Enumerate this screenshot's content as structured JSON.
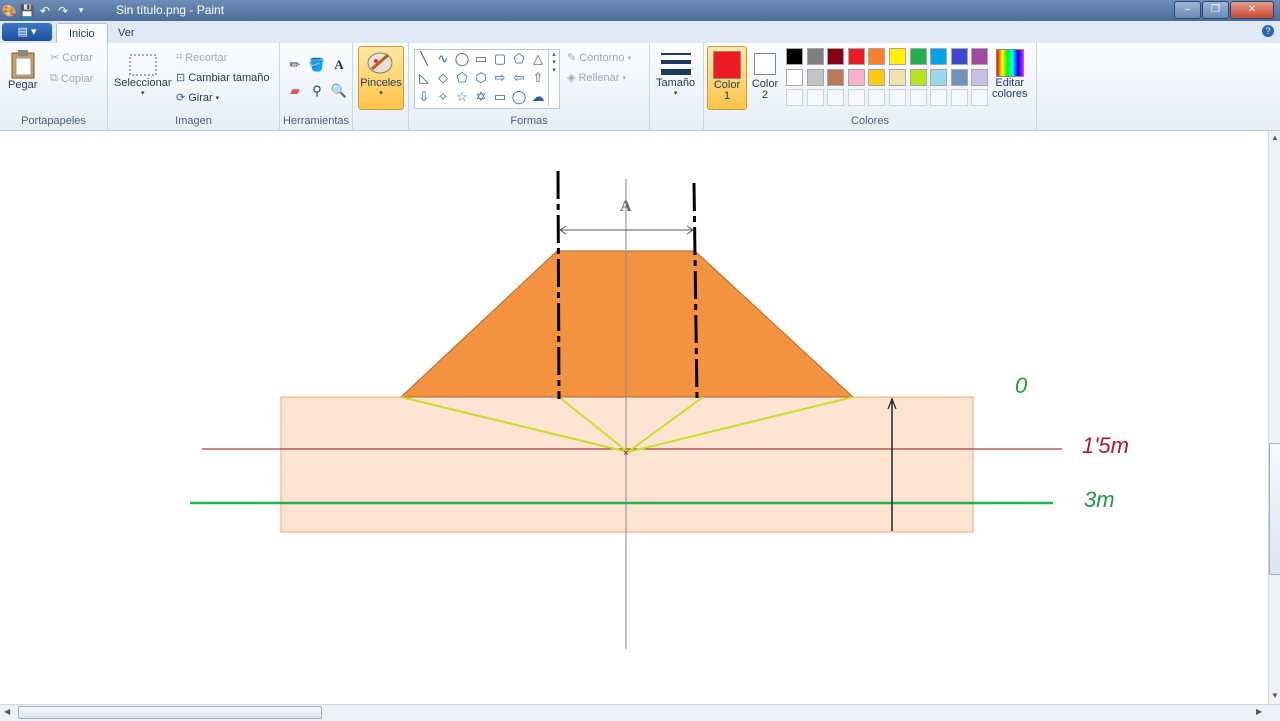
{
  "window": {
    "title": "Sin título.png - Paint",
    "minimize": "–",
    "restore": "❐",
    "close": "✕"
  },
  "tabs": {
    "app_menu": "▤ ▾",
    "inicio": "Inicio",
    "ver": "Ver",
    "help": "?"
  },
  "ribbon": {
    "portapapeles": {
      "label": "Portapapeles",
      "pegar": "Pegar",
      "cortar": "Cortar",
      "copiar": "Copiar"
    },
    "imagen": {
      "label": "Imagen",
      "seleccionar": "Seleccionar",
      "recortar": "Recortar",
      "cambiar_tamano": "Cambiar tamaño",
      "girar": "Girar"
    },
    "herramientas": {
      "label": "Herramientas"
    },
    "pinceles": {
      "label": "Pinceles"
    },
    "formas": {
      "label": "Formas",
      "contorno": "Contorno",
      "rellenar": "Rellenar"
    },
    "tamano": {
      "label": "Tamaño"
    },
    "color1": {
      "label": "Color",
      "num": "1",
      "value": "#ed1c24"
    },
    "color2": {
      "label": "Color",
      "num": "2",
      "value": "#ffffff"
    },
    "colores": {
      "label": "Colores",
      "editar": "Editar",
      "editar2": "colores",
      "row1": [
        "#000000",
        "#7f7f7f",
        "#880015",
        "#ed1c24",
        "#ff7f27",
        "#fff200",
        "#22b14c",
        "#00a2e8",
        "#3f48cc",
        "#a349a4"
      ],
      "row2": [
        "#ffffff",
        "#c3c3c3",
        "#b97a57",
        "#ffaec9",
        "#ffc90e",
        "#efe4b0",
        "#b5e61d",
        "#99d9ea",
        "#7092be",
        "#c8bfe7"
      ]
    }
  },
  "canvas": {
    "label_a": "A",
    "label_zero": "0",
    "label_15m": "1'5m",
    "label_3m": "3m",
    "colors": {
      "trapezoid": "#f39240",
      "soil": "#fde3d1",
      "soil_border": "#f5a46b",
      "yellow_lines": "#c5e02a",
      "green_line": "#22b14c",
      "red_line": "#8b1a1a",
      "red_text": "#b5162c",
      "green_text": "#1a9b42"
    }
  }
}
